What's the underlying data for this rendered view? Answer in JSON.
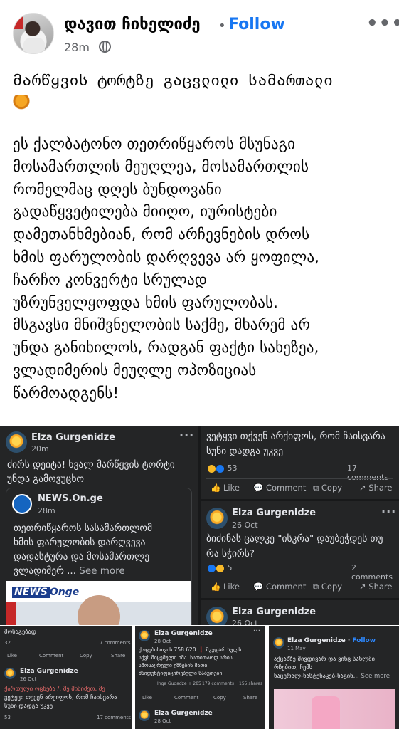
{
  "header": {
    "author": "დავით ჩიხელიძე",
    "separator": "•",
    "follow_label": "Follow",
    "time": "28m",
    "more": "•••"
  },
  "post": {
    "title": "მარწყვის ტორტზე გაცვლილი სამართალი",
    "body_lines": [
      "ეს ქალბატონო თეთრიწყაროს  მსუნაგი",
      "მოსამართლის მეუღლეა, მოსამართლის",
      "რომელმაც დღეს ბუნდოვანი",
      "გადაწყვეტილება მიიღო, იურისტები",
      "დამეთანხმებიან, რომ არჩევნების დროს",
      "ხმის ფარულობის დარღვევა არ ყოფილა,",
      "ჩარჩო კონვერტი სრულად",
      "უზრუნველყოფდა ხმის ფარულობას.",
      "მსგავსი მნიშვნელობის საქმე,  მხარემ არ",
      "უნდა განიხილოს, რადგან ფაქტი სახეზეა,",
      "ვლადიმერის მეუღლე ოპოზიციას",
      "წარმოადგენს!"
    ]
  },
  "screenshot_left": {
    "name": "Elza Gurgenidze",
    "time": "20m",
    "text_lines": [
      "ძირს დეიტა! ხვალ მარწყვის ტორტი",
      "უნდა გამოვუცხო"
    ],
    "shared": {
      "source": "NEWS.On.ge",
      "time": "28m",
      "text_lines": [
        "თეთრიწყაროს სასამართლომ",
        "ხმის ფარულობის დარღვევა",
        "დადასტურა და მოსამართლე",
        "ვლადიმერ ..."
      ],
      "see_more": "See more",
      "logo": "NEWS",
      "logo2": "Onge"
    }
  },
  "screenshot_right": {
    "top_text_lines": [
      "ვეტყვი თქვენ არქიფოს, რომ ჩაისვარა",
      "სუნი დადგა უკვე"
    ],
    "top_reactions": "53",
    "top_comments": "17 comments",
    "actions": [
      "Like",
      "Comment",
      "Copy",
      "Share"
    ],
    "comment2": {
      "name": "Elza Gurgenidze",
      "time": "26 Oct",
      "text_lines": [
        "ბიძინას ცალკე \"ისკრა\" დაუბეჭდეს თუ",
        "რა სჭირს?"
      ],
      "reactions": "5",
      "comments": "2 comments"
    },
    "comment3": {
      "name": "Elza Gurgenidze",
      "time": "26 Oct"
    }
  },
  "mosaic": {
    "a": {
      "top_text": "მოსაგებად",
      "reactions": "32",
      "comments": "7 comments",
      "actions": [
        "Like",
        "Comment",
        "Copy",
        "Share"
      ],
      "name": "Elza Gurgenidze",
      "time": "26 Oct",
      "text_lines": [
        "ქართული ოცნება /, მე მიმიშეთ, მე",
        "ვეტყვი თქვენ არქიფოს, რომ ჩაისვარა",
        "სუნი დადგა უკვე"
      ],
      "reactions2": "53",
      "comments2": "17 comments"
    },
    "b": {
      "name": "Elza Gurgenidze",
      "time": "28 Oct",
      "text_lines": [
        "ქოცებისთვის 758 620 ❗ მკვდარ სულს",
        "აქვს მიცემული ხმა. სათითაოდ არის",
        "ამოსაყრელი ეზნების მათი",
        "მაიდენტიფიცირებელი საბუთები."
      ],
      "reaction_names": "Inga Gudadze + 285",
      "comments": "179 comments",
      "shares": "155 shares",
      "actions": [
        "Like",
        "Comment",
        "Copy",
        "Share"
      ],
      "name2": "Elza Gurgenidze",
      "time2": "28 Oct"
    },
    "c": {
      "name": "Elza Gurgenidze",
      "follow": "Follow",
      "time": "11 May",
      "text_lines": [
        "აქცაბზე მივდივარ და ვინც სახლში",
        "რჩებით, ჩემს",
        "ნაცერალ-ნასტენაკებ-ნაგინ..."
      ],
      "see_more": "See more"
    }
  }
}
